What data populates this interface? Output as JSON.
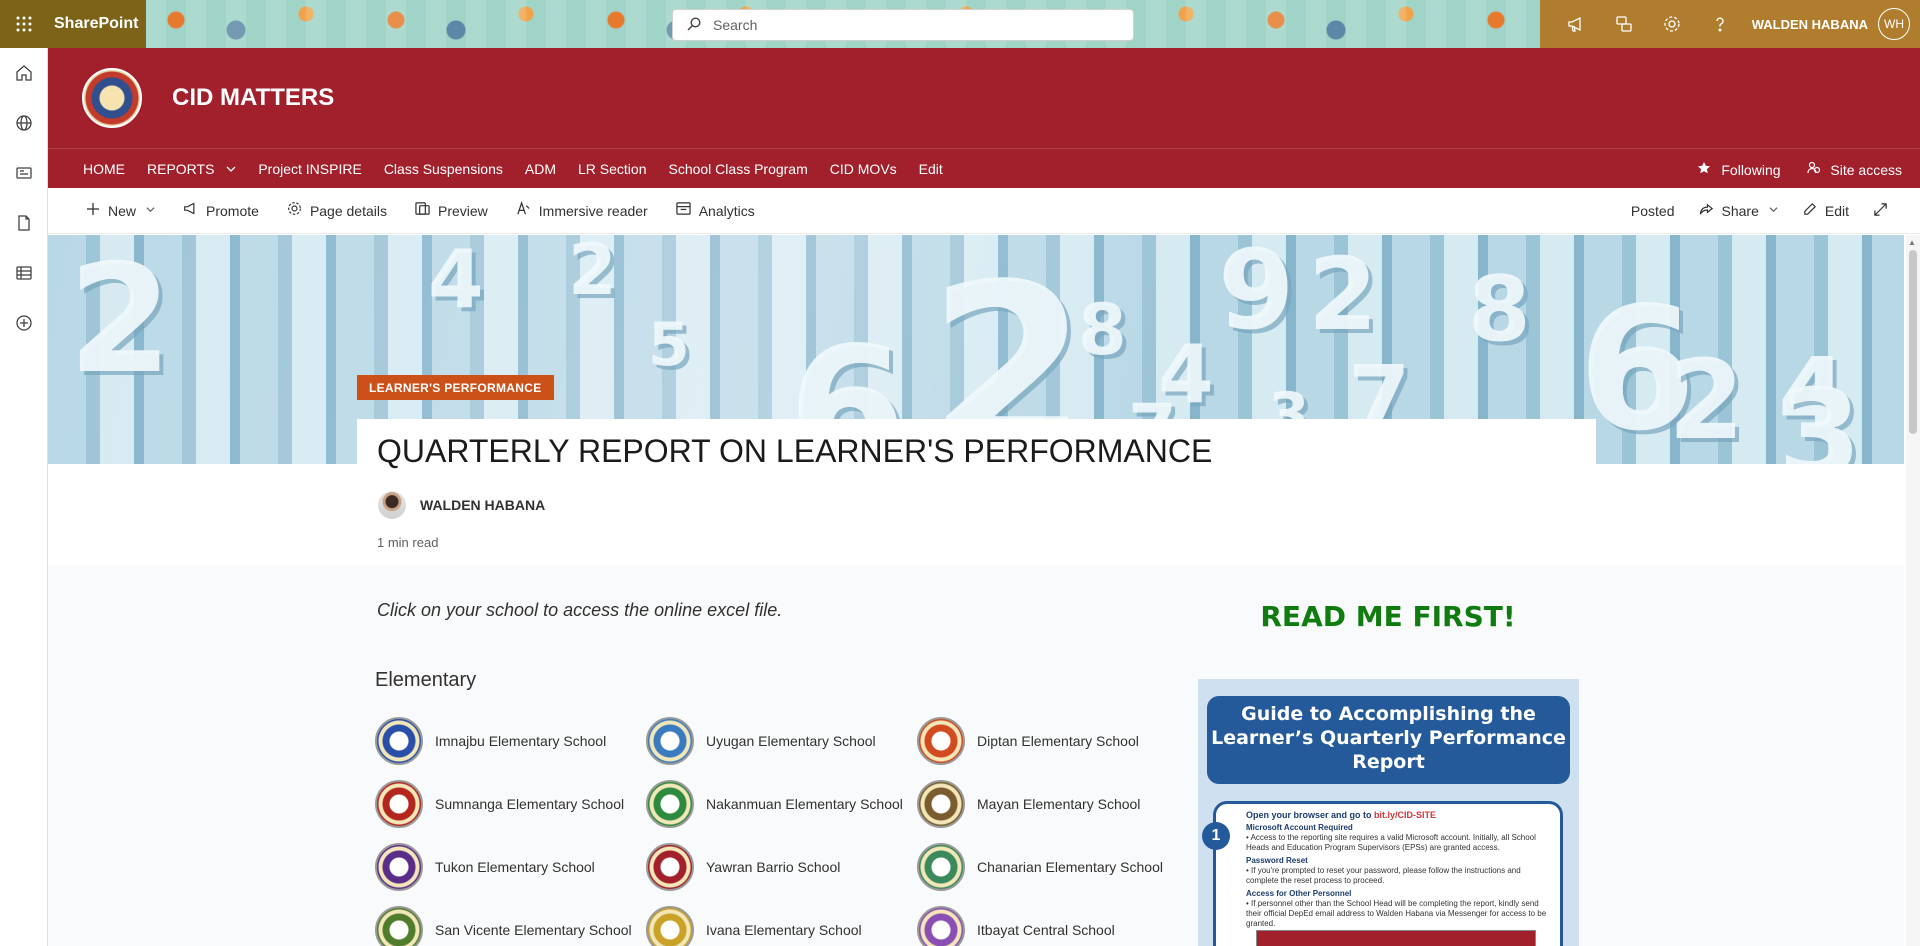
{
  "suite_bar": {
    "app_name": "SharePoint",
    "search_placeholder": "Search",
    "user_name": "WALDEN HABANA",
    "user_initials": "WH",
    "icons": [
      "waffle-icon",
      "megaphone-icon",
      "chat-icon",
      "gear-icon",
      "help-icon"
    ]
  },
  "left_rail": {
    "icons": [
      "home-icon",
      "globe-icon",
      "news-icon",
      "document-icon",
      "list-icon",
      "add-icon"
    ]
  },
  "site_header": {
    "title": "CID MATTERS"
  },
  "site_nav": {
    "items": [
      "HOME",
      "REPORTS",
      "Project INSPIRE",
      "Class Suspensions",
      "ADM",
      "LR Section",
      "School Class Program",
      "CID MOVs",
      "Edit"
    ],
    "following": "Following",
    "site_access": "Site access"
  },
  "command_bar": {
    "new": "New",
    "promote": "Promote",
    "page_details": "Page details",
    "preview": "Preview",
    "immersive_reader": "Immersive reader",
    "analytics": "Analytics",
    "posted": "Posted",
    "share": "Share",
    "edit": "Edit"
  },
  "hero": {
    "digits": [
      "2",
      "4",
      "2",
      "8",
      "6",
      "2",
      "4",
      "5",
      "9",
      "2",
      "8",
      "6",
      "3",
      "7",
      "2",
      "4",
      "7",
      "3"
    ]
  },
  "page": {
    "topic": "LEARNER'S PERFORMANCE",
    "title": "QUARTERLY REPORT ON LEARNER'S PERFORMANCE",
    "author": "WALDEN HABANA",
    "read_time": "1 min read",
    "intro": "Click on your school to access the online excel file.",
    "read_me": "READ ME FIRST!",
    "section_heading": "Elementary"
  },
  "schools": [
    {
      "name": "Imnajbu Elementary School",
      "color": "#2a4fa8"
    },
    {
      "name": "Uyugan Elementary School",
      "color": "#3a7bbf"
    },
    {
      "name": "Diptan Elementary School",
      "color": "#d24a1f"
    },
    {
      "name": "Sumnanga Elementary School",
      "color": "#b3261e"
    },
    {
      "name": "Nakanmuan Elementary School",
      "color": "#2d8a3e"
    },
    {
      "name": "Mayan Elementary School",
      "color": "#7a5c2e"
    },
    {
      "name": "Tukon Elementary School",
      "color": "#5b2d8a"
    },
    {
      "name": "Yawran Barrio School",
      "color": "#a1202c"
    },
    {
      "name": "Chanarian Elementary School",
      "color": "#3b8a5c"
    },
    {
      "name": "San Vicente Elementary School",
      "color": "#4f7d2c"
    },
    {
      "name": "Ivana Elementary School",
      "color": "#c9a227"
    },
    {
      "name": "Itbayat Central School",
      "color": "#8a4fb3"
    }
  ],
  "guide": {
    "heading": "Guide to Accomplishing the Learner’s Quarterly Performance Report",
    "step_number": "1",
    "step_title_prefix": "Open your browser and go to ",
    "step_link": "bit.ly/CID-SITE",
    "h1": "Microsoft Account Required",
    "t1": "• Access to the reporting site requires a valid Microsoft account. Initially, all School Heads and Education Program Supervisors (EPSs) are granted access.",
    "h2": "Password Reset",
    "t2": "• If you're prompted to reset your password, please follow the instructions and complete the reset process to proceed.",
    "h3": "Access for Other Personnel",
    "t3": "• If personnel other than the School Head will be completing the report, kindly send their official DepEd email address to Walden Habana via Messenger for access to be granted."
  }
}
